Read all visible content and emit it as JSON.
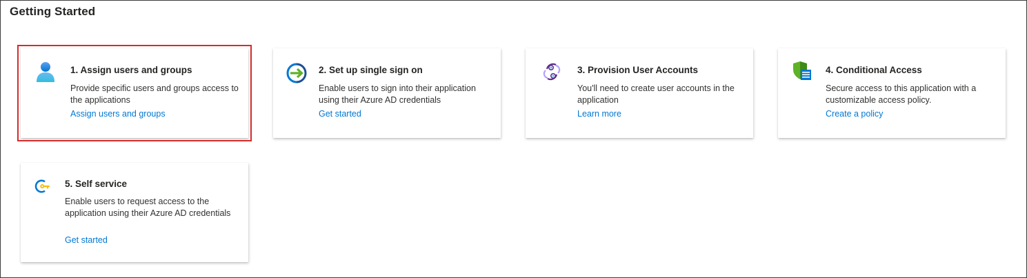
{
  "section": {
    "title": "Getting Started"
  },
  "cards": [
    {
      "title": "1. Assign users and groups",
      "description": "Provide specific users and groups access to the applications",
      "link": "Assign users and groups",
      "icon": "user-icon",
      "highlighted": true
    },
    {
      "title": "2. Set up single sign on",
      "description": "Enable users to sign into their application using their Azure AD credentials",
      "link": "Get started",
      "icon": "sign-in-arrow-icon"
    },
    {
      "title": "3. Provision User Accounts",
      "description": "You'll need to create user accounts in the application",
      "link": "Learn more",
      "icon": "provisioning-sync-icon"
    },
    {
      "title": "4. Conditional Access",
      "description": "Secure access to this application with a customizable access policy.",
      "link": "Create a policy",
      "icon": "shield-policy-icon"
    },
    {
      "title": "5. Self service",
      "description": "Enable users to request access to the application using their Azure AD credentials",
      "link": "Get started",
      "icon": "self-service-key-icon"
    }
  ],
  "colors": {
    "link": "#0078d4",
    "highlight_border": "#d62a2a",
    "frame_border": "#3b3b3b"
  }
}
